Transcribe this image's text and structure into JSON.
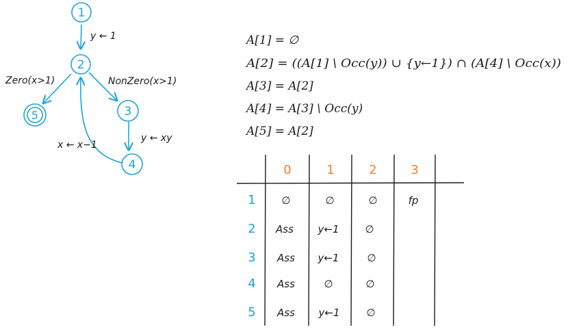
{
  "graph": {
    "nodes": [
      {
        "id": "1",
        "label": "1"
      },
      {
        "id": "2",
        "label": "2"
      },
      {
        "id": "3",
        "label": "3"
      },
      {
        "id": "4",
        "label": "4"
      },
      {
        "id": "5",
        "label": "5"
      }
    ],
    "edges": [
      {
        "from": "1",
        "to": "2",
        "label": "y ← 1"
      },
      {
        "from": "2",
        "to": "5",
        "label": "Zero(x>1)"
      },
      {
        "from": "2",
        "to": "3",
        "label": "NonZero(x>1)"
      },
      {
        "from": "3",
        "to": "4",
        "label": "y ← xy"
      },
      {
        "from": "4",
        "to": "2",
        "label": "x ← x−1"
      }
    ],
    "color": "#1ea3d6"
  },
  "equations": [
    "A[1] = ∅",
    "A[2] = ((A[1] \\ Occ(y)) ∪ {y←1}) ∩ (A[4] \\ Occ(x))",
    "A[3] = A[2]",
    "A[4] = A[3] \\ Occ(y)",
    "A[5] = A[2]"
  ],
  "table": {
    "columns": [
      "0",
      "1",
      "2",
      "3"
    ],
    "rows": [
      {
        "label": "1",
        "cells": [
          "∅",
          "∅",
          "∅",
          "fp"
        ]
      },
      {
        "label": "2",
        "cells": [
          "Ass",
          "y←1",
          "∅",
          ""
        ]
      },
      {
        "label": "3",
        "cells": [
          "Ass",
          "y←1",
          "∅",
          ""
        ]
      },
      {
        "label": "4",
        "cells": [
          "Ass",
          "∅",
          "∅",
          ""
        ]
      },
      {
        "label": "5",
        "cells": [
          "Ass",
          "y←1",
          "∅",
          ""
        ]
      }
    ],
    "header_color": "#f08030",
    "row_label_color": "#1ea3d6"
  }
}
